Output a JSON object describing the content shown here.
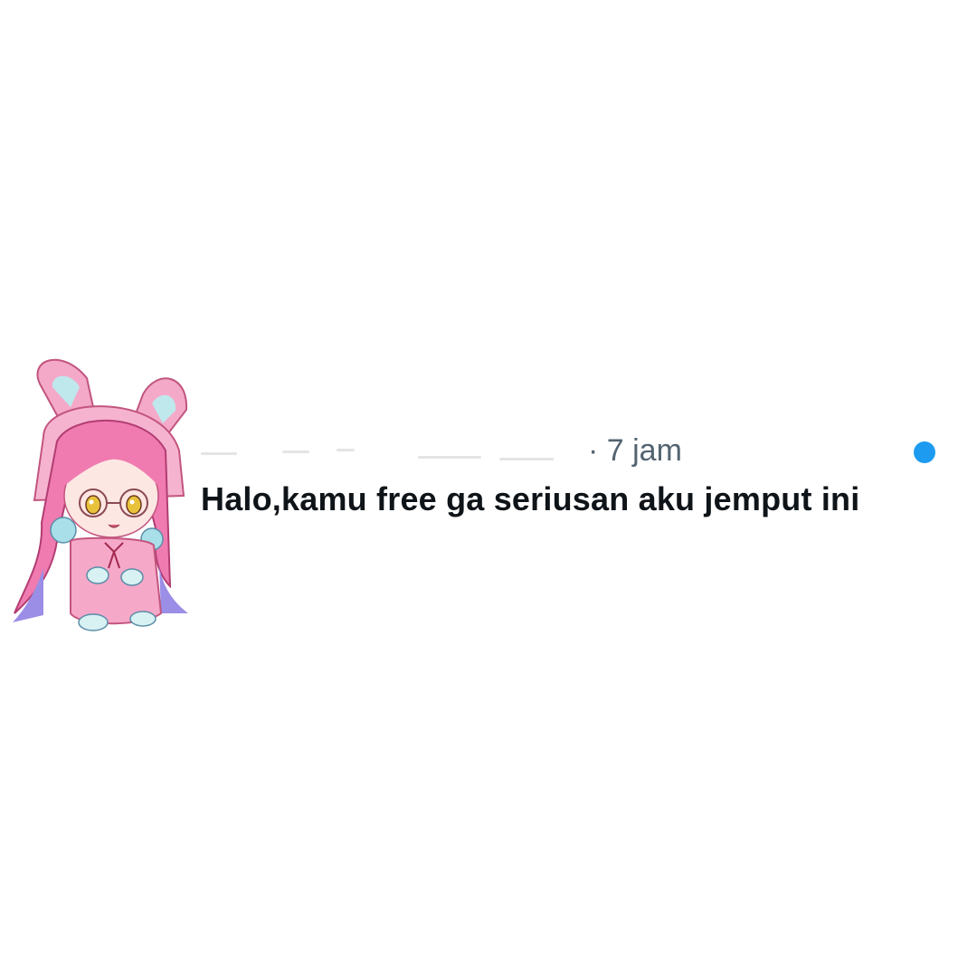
{
  "conversation": {
    "timestamp": "· 7 jam",
    "message": "Halo,kamu free ga seriusan aku jemput ini",
    "unread_dot_color": "#1d9bf0",
    "avatar_icon": "anime-bunny-hood-avatar"
  }
}
